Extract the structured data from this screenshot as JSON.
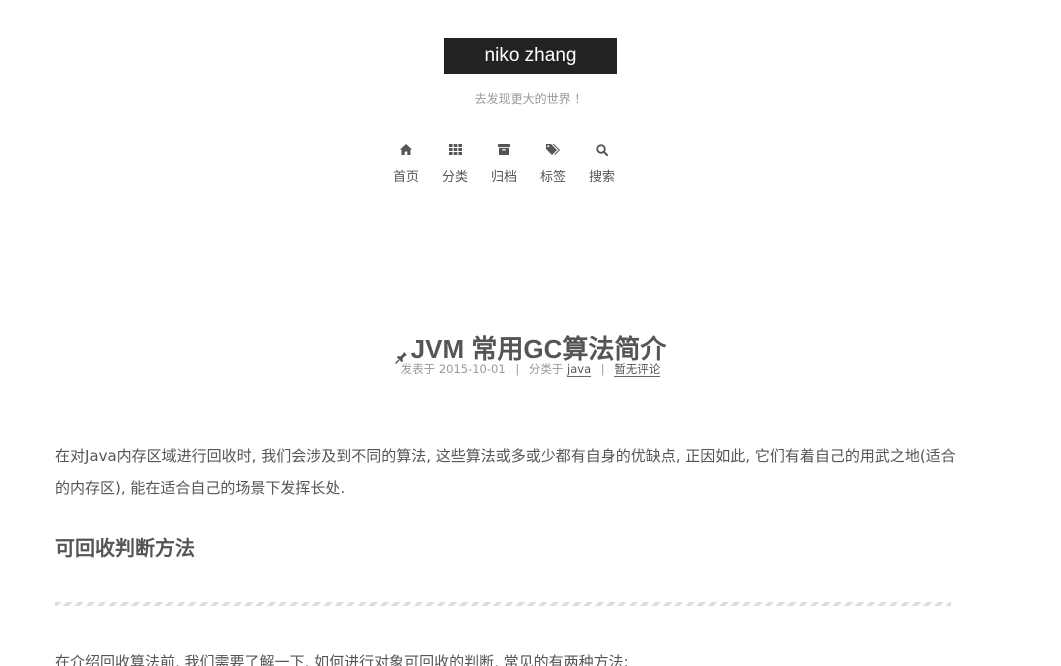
{
  "site": {
    "title": "niko zhang",
    "subtitle": "去发现更大的世界 ！"
  },
  "nav": {
    "items": [
      {
        "label": "首页",
        "icon": "home-icon"
      },
      {
        "label": "分类",
        "icon": "th-icon"
      },
      {
        "label": "归档",
        "icon": "archive-icon"
      },
      {
        "label": "标签",
        "icon": "tags-icon"
      },
      {
        "label": "搜索",
        "icon": "search-icon"
      }
    ]
  },
  "post": {
    "title": "JVM 常用GC算法简介",
    "pinned_icon": "pin-icon",
    "meta": {
      "posted_label": "发表于",
      "date": "2015-10-01",
      "category_label": "分类于",
      "category": "java",
      "comments": "暂无评论"
    },
    "paragraph1": "在对Java内存区域进行回收时, 我们会涉及到不同的算法, 这些算法或多或少都有自身的优缺点, 正因如此, 它们有着自己的用武之地(适合的内存区), 能在适合自己的场景下发挥长处.",
    "heading1": "可回收判断方法",
    "paragraph2": "在介绍回收算法前, 我们需要了解一下, 如何进行对象可回收的判断, 常见的有两种方法:"
  },
  "colors": {
    "brand_bg": "#222222",
    "text": "#555555",
    "muted": "#999999"
  }
}
